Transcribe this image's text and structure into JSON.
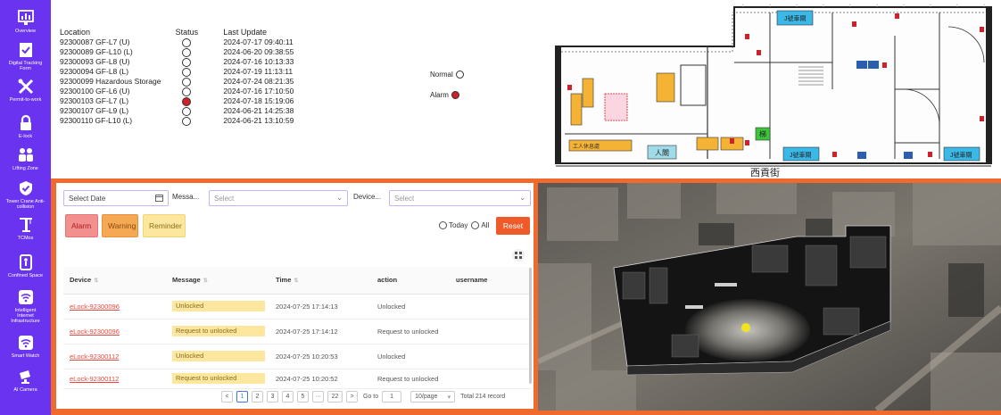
{
  "sidebar": {
    "items": [
      {
        "label": "Overview",
        "icon": "dashboard-icon"
      },
      {
        "label": "Digital Tracking\nForm",
        "icon": "form-icon"
      },
      {
        "label": "Permit-to-work",
        "icon": "tools-icon"
      },
      {
        "label": "E-lock",
        "icon": "lock-icon"
      },
      {
        "label": "Lifting Zone",
        "icon": "people-icon"
      },
      {
        "label": "Tower Crane Anti-\ncollision",
        "icon": "shield-check-icon"
      },
      {
        "label": "TCMos",
        "icon": "crane-icon"
      },
      {
        "label": "Confined Space",
        "icon": "confined-space-icon"
      },
      {
        "label": "Intelligent\nInternet\nInfrastructure",
        "icon": "wifi-icon"
      },
      {
        "label": "Smart Watch",
        "icon": "wifi-icon"
      },
      {
        "label": "AI Camera",
        "icon": "camera-icon"
      }
    ]
  },
  "status": {
    "headers": {
      "location": "Location",
      "status": "Status",
      "last_update": "Last Update"
    },
    "rows": [
      {
        "location": "92300087 GF-L7 (U)",
        "state": "normal",
        "time": "2024-07-17 09:40:11"
      },
      {
        "location": "92300089 GF-L10 (L)",
        "state": "normal",
        "time": "2024-06-20 09:38:55"
      },
      {
        "location": "92300093 GF-L8 (U)",
        "state": "normal",
        "time": "2024-07-16 10:13:33"
      },
      {
        "location": "92300094 GF-L8 (L)",
        "state": "normal",
        "time": "2024-07-19 11:13:11"
      },
      {
        "location": "92300099 Hazardous Storage",
        "state": "normal",
        "time": "2024-07-24 08:21:35"
      },
      {
        "location": "92300100 GF-L6 (U)",
        "state": "normal",
        "time": "2024-07-16 17:10:50"
      },
      {
        "location": "92300103 GF-L7 (L)",
        "state": "alarm",
        "time": "2024-07-18 15:19:06"
      },
      {
        "location": "92300107 GF-L9 (L)",
        "state": "normal",
        "time": "2024-06-21 14:25:38"
      },
      {
        "location": "92300110 GF-L10 (L)",
        "state": "normal",
        "time": "2024-06-21 13:10:59"
      }
    ],
    "legend": {
      "normal": "Normal",
      "alarm": "Alarm"
    }
  },
  "floorplan": {
    "street_label": "西貢街",
    "room_labels": {
      "top_room": "J號車閘",
      "shop": "工人休息處",
      "people": "人閘",
      "green": "梯",
      "right1": "J號車閘",
      "right2": "J號車閘"
    }
  },
  "filters": {
    "date_placeholder": "Select Date",
    "message_label": "Messa...",
    "message_placeholder": "Select",
    "device_label": "Device...",
    "device_placeholder": "Select",
    "tags": {
      "alarm": "Alarm",
      "warning": "Warning",
      "reminder": "Reminder"
    },
    "today": "Today",
    "all": "All",
    "reset": "Reset"
  },
  "table": {
    "columns": [
      "Device",
      "Message",
      "Time",
      "action",
      "username"
    ],
    "rows": [
      {
        "device": "eLock-92300096",
        "message": "Unlocked",
        "time": "2024-07-25 17:14:13",
        "action": "Unlocked",
        "username": ""
      },
      {
        "device": "eLock-92300096",
        "message": "Request to unlocked",
        "time": "2024-07-25 17:14:12",
        "action": "Request to unlocked",
        "username": ""
      },
      {
        "device": "eLock-92300112",
        "message": "Unlocked",
        "time": "2024-07-25 10:20:53",
        "action": "Unlocked",
        "username": ""
      },
      {
        "device": "eLock-92300112",
        "message": "Request to unlocked",
        "time": "2024-07-25 10:20:52",
        "action": "Request to unlocked",
        "username": ""
      }
    ]
  },
  "pagination": {
    "prev": "<",
    "pages": [
      "1",
      "2",
      "3",
      "4",
      "5",
      "···",
      "22"
    ],
    "next": ">",
    "goto_label": "Go to",
    "goto_value": "1",
    "page_size": "10/page",
    "total": "Total 214 record"
  },
  "colors": {
    "sidebar": "#6a33f0",
    "frame": "#ef6a2c",
    "alarm": "#d0202a",
    "alarm_tag": "#f28f8f",
    "warning_tag": "#f6a955",
    "reminder_tag": "#fde79f"
  }
}
